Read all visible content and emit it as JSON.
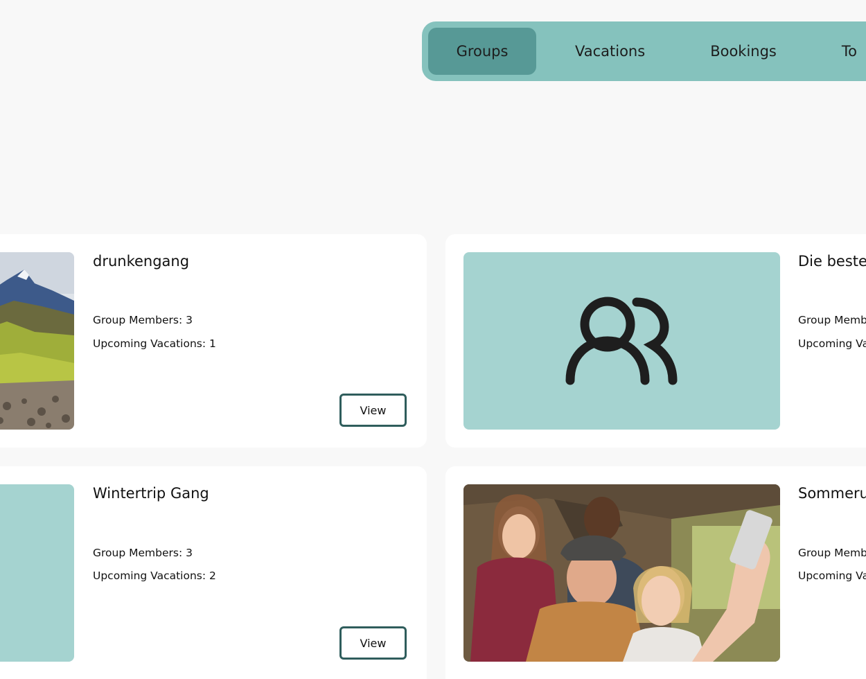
{
  "nav": {
    "items": [
      {
        "label": "Groups",
        "active": true
      },
      {
        "label": "Vacations",
        "active": false
      },
      {
        "label": "Bookings",
        "active": false
      },
      {
        "label": "To",
        "active": false
      }
    ],
    "colors": {
      "bar": "#85c2bd",
      "active": "#579996"
    }
  },
  "groups": [
    {
      "title": "drunkengang",
      "members_text": "Group Members: 3",
      "vacations_text": "Upcoming Vacations: 1",
      "view_label": "View",
      "image": "mountain-landscape-photo"
    },
    {
      "title": "Die beste",
      "members_text": "Group Memb",
      "vacations_text": "Upcoming Va",
      "image": "group-placeholder-icon"
    },
    {
      "title": "Wintertrip Gang",
      "members_text": "Group Members: 3",
      "vacations_text": "Upcoming Vacations: 2",
      "view_label": "View",
      "image": "placeholder-teal"
    },
    {
      "title": "Sommeru",
      "members_text": "Group Memb",
      "vacations_text": "Upcoming Va",
      "image": "friends-selfie-photo"
    }
  ]
}
